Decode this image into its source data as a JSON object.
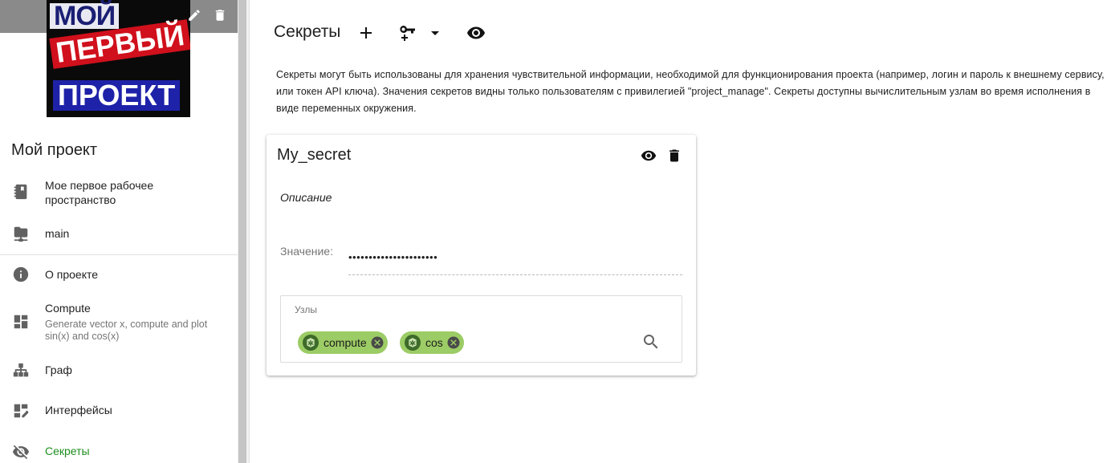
{
  "sidebar": {
    "logo_lines": [
      "МОЙ",
      "ПЕРВЫЙ",
      "ПРОЕКТ"
    ],
    "project_title": "Мой проект",
    "items": [
      {
        "label": "Мое первое рабочее пространство",
        "icon": "notebook-icon"
      },
      {
        "label": "main",
        "icon": "folder-network-icon"
      },
      {
        "label": "О проекте",
        "icon": "info-icon"
      },
      {
        "label": "Compute",
        "sub": "Generate vector x, compute and plot sin(x) and cos(x)",
        "icon": "dashboard-icon"
      },
      {
        "label": "Граф",
        "icon": "sitemap-icon"
      },
      {
        "label": "Интерфейсы",
        "icon": "dashboard-edit-icon"
      },
      {
        "label": "Секреты",
        "icon": "eye-off-icon",
        "active": true
      }
    ]
  },
  "main": {
    "title": "Секреты",
    "description": "Секреты могут быть использованы для хранения чувствительной информации, необходимой для функционирования проекта (например, логин и пароль к внешнему сервису, или токен API ключа). Значения секретов видны только пользователям с привилегией \"project_manage\". Секреты доступны вычислительным узлам во время исполнения в виде переменных окружения."
  },
  "secret": {
    "name": "My_secret",
    "description": "Описание",
    "value_label": "Значение:",
    "value_masked": "••••••••••••••••••••••",
    "nodes_label": "Узлы",
    "nodes": [
      "compute",
      "cos"
    ]
  },
  "colors": {
    "active_nav": "#1e8e1e",
    "chip_bg": "#9ccc65",
    "header_band": "#8a8a8a"
  }
}
